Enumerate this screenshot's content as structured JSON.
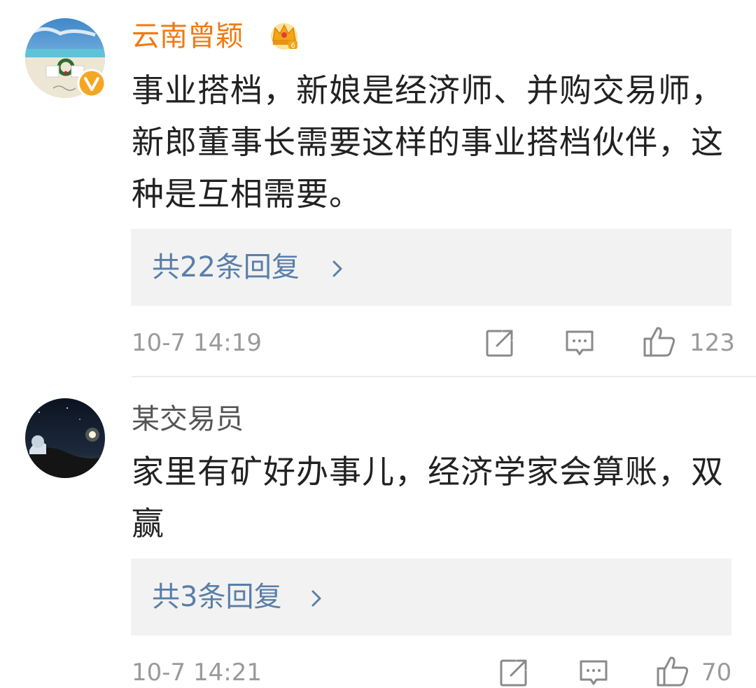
{
  "comments": [
    {
      "username": "云南曾颖",
      "verified": true,
      "crown_badge": true,
      "text": "事业搭档，新娘是经济师、并购交易师，新郎董事长需要这样的事业搭档伙伴，这种是互相需要。",
      "replies_label": "共22条回复",
      "timestamp": "10-7 14:19",
      "likes": "123"
    },
    {
      "username": "某交易员",
      "verified": false,
      "crown_badge": false,
      "text": "家里有矿好办事儿，经济学家会算账，双赢",
      "replies_label": "共3条回复",
      "timestamp": "10-7 14:21",
      "likes": "70"
    }
  ],
  "icons": {
    "share": "share-icon",
    "comment": "comment-icon",
    "like": "thumbs-up-icon",
    "reply_arrow": "chevron-right-icon",
    "verified": "verified-badge-icon",
    "crown": "crown-badge-icon"
  },
  "colors": {
    "username_vip": "#f07a12",
    "username_normal": "#555555",
    "text": "#222222",
    "link": "#5a7ea8",
    "meta": "#9a9a9a",
    "reply_bg": "#f2f2f2",
    "verified_badge": "#f5a623"
  }
}
